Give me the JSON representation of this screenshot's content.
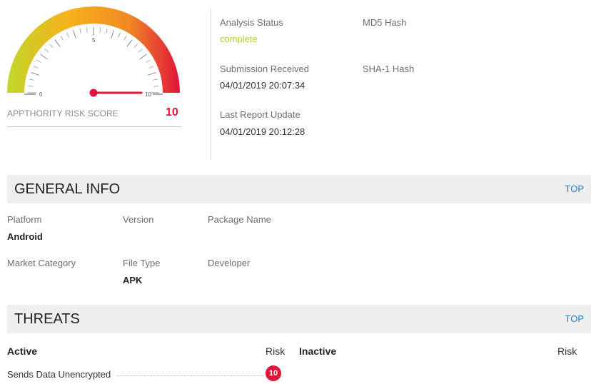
{
  "risk_score": {
    "label": "APPTHORITY RISK SCORE",
    "value": "10",
    "gauge": {
      "min_label": "0",
      "mid_label": "5",
      "max_label": "10",
      "fraction": 1.0
    }
  },
  "analysis": {
    "status_label": "Analysis Status",
    "status_value": "complete",
    "md5_label": "MD5 Hash",
    "md5_value": "",
    "submission_label": "Submission Received",
    "submission_value": "04/01/2019 20:07:34",
    "sha1_label": "SHA-1 Hash",
    "sha1_value": "",
    "last_update_label": "Last Report Update",
    "last_update_value": "04/01/2019 20:12:28"
  },
  "general_info": {
    "title": "GENERAL INFO",
    "top_link": "TOP",
    "platform_label": "Platform",
    "platform_value": "Android",
    "version_label": "Version",
    "version_value": "",
    "package_label": "Package Name",
    "package_value": "",
    "market_label": "Market Category",
    "market_value": "",
    "filetype_label": "File Type",
    "filetype_value": "APK",
    "developer_label": "Developer",
    "developer_value": ""
  },
  "threats": {
    "title": "THREATS",
    "top_link": "TOP",
    "active_header": "Active",
    "active_risk_header": "Risk",
    "inactive_header": "Inactive",
    "inactive_risk_header": "Risk",
    "active_items": [
      {
        "name": "Sends Data Unencrypted",
        "risk": "10"
      }
    ]
  },
  "colors": {
    "accent_red": "#e0153a",
    "status_green": "#b8cc2f",
    "link_blue": "#2a7ab8",
    "section_bg": "#efefef",
    "gauge_stops": [
      "#c2d62b",
      "#f6b21c",
      "#f08a24",
      "#e0153a"
    ]
  }
}
